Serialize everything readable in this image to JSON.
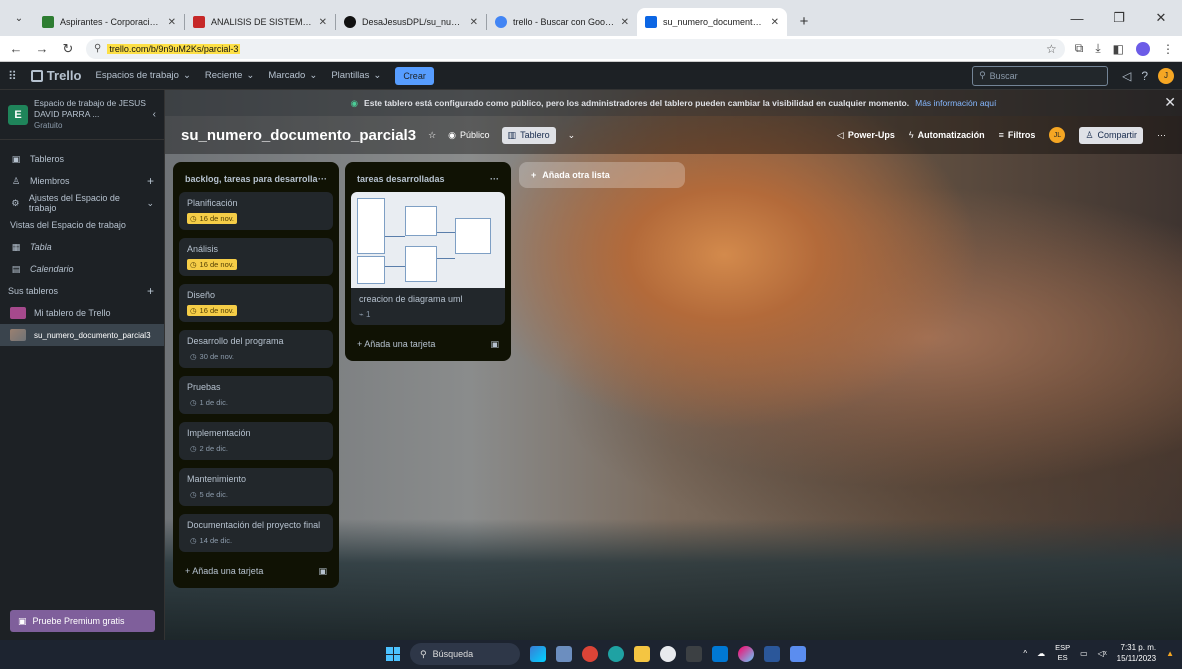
{
  "browser": {
    "tabs": [
      {
        "title": "Aspirantes - Corporación Univ",
        "fav": "#2e7d32",
        "active": false
      },
      {
        "title": "ANALISIS DE SISTEMAS [G1]-",
        "fav": "#c62828",
        "active": false
      },
      {
        "title": "DesaJesusDPL/su_numero_do",
        "fav": "#111111",
        "active": false
      },
      {
        "title": "trello - Buscar con Google",
        "fav": "#4285f4",
        "active": false
      },
      {
        "title": "su_numero_documento_parcia",
        "fav": "#0c66e4",
        "active": true
      }
    ],
    "url": "trello.com/b/9n9uM2Ks/parcial-3"
  },
  "header": {
    "logo": "Trello",
    "menus": [
      "Espacios de trabajo",
      "Reciente",
      "Marcado",
      "Plantillas"
    ],
    "create": "Crear",
    "search_placeholder": "Buscar"
  },
  "sidebar": {
    "workspace_name": "Espacio de trabajo de JESUS DAVID PARRA ...",
    "workspace_badge": "E",
    "workspace_tier": "Gratuito",
    "items": [
      {
        "label": "Tableros",
        "icon": "board-icon"
      },
      {
        "label": "Miembros",
        "icon": "members-icon"
      },
      {
        "label": "Ajustes del Espacio de trabajo",
        "icon": "settings-icon"
      }
    ],
    "views_heading": "Vistas del Espacio de trabajo",
    "views": [
      {
        "label": "Tabla",
        "icon": "table-icon"
      },
      {
        "label": "Calendario",
        "icon": "calendar-icon"
      }
    ],
    "boards_heading": "Sus tableros",
    "boards": [
      {
        "label": "Mi tablero de Trello",
        "color": "#a5498c"
      },
      {
        "label": "su_numero_documento_parcial3",
        "color": "#8a8c8c"
      }
    ],
    "premium": "Pruebe Premium gratis"
  },
  "banner": {
    "text": "Este tablero está configurado como público, pero los administradores del tablero pueden cambiar la visibilidad en cualquier momento.",
    "link": "Más información aquí"
  },
  "board": {
    "name": "su_numero_documento_parcial3",
    "visibility": "Público",
    "view": "Tablero",
    "power_ups": "Power-Ups",
    "automation": "Automatización",
    "filters": "Filtros",
    "avatar": "JL",
    "share": "Compartir"
  },
  "lists": [
    {
      "title": "backlog, tareas para desarrolla",
      "cards": [
        {
          "title": "Planificación",
          "due": "16 de nov.",
          "warn": true
        },
        {
          "title": "Análisis",
          "due": "16 de nov.",
          "warn": true
        },
        {
          "title": "Diseño",
          "due": "16 de nov.",
          "warn": true
        },
        {
          "title": "Desarrollo del programa",
          "due": "30 de nov.",
          "warn": false
        },
        {
          "title": "Pruebas",
          "due": "1 de dic.",
          "warn": false
        },
        {
          "title": "Implementación",
          "due": "2 de dic.",
          "warn": false
        },
        {
          "title": "Mantenimiento",
          "due": "5 de dic.",
          "warn": false
        },
        {
          "title": "Documentación del proyecto final",
          "due": "14 de dic.",
          "warn": false
        }
      ],
      "add": "Añada una tarjeta"
    },
    {
      "title": "tareas desarrolladas",
      "image_card": {
        "title": "creacion de diagrama uml",
        "attachments": "1"
      },
      "add": "Añada una tarjeta"
    }
  ],
  "add_list": "Añada otra lista",
  "taskbar": {
    "search": "Búsqueda",
    "lang_top": "ESP",
    "lang_bottom": "ES",
    "time": "7:31 p. m.",
    "date": "15/11/2023"
  }
}
